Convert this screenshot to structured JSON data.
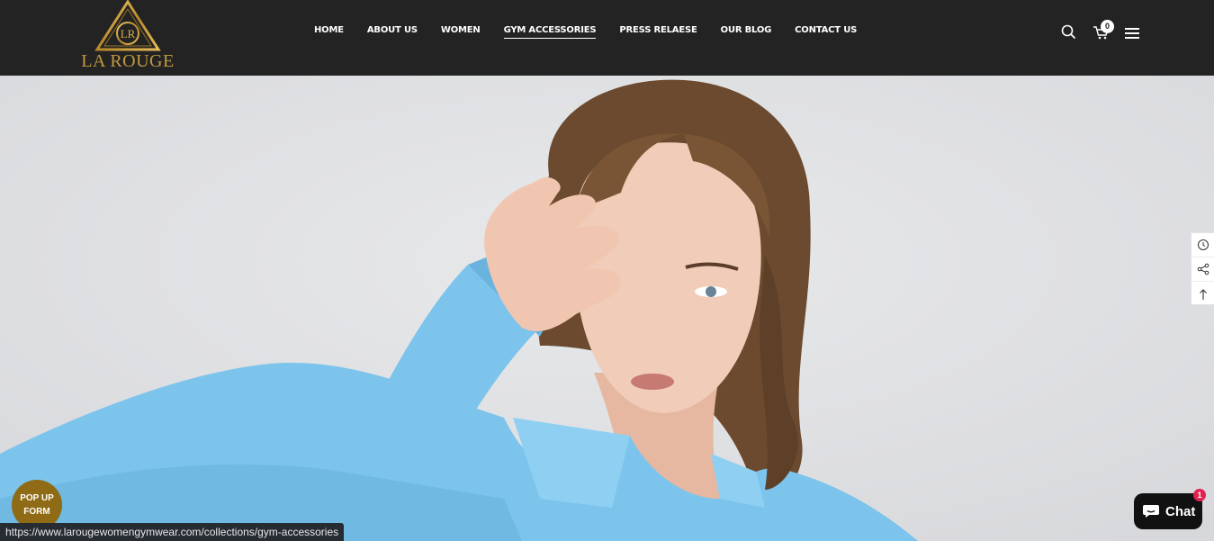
{
  "brand": {
    "name": "LA ROUGE",
    "monogram": "LR",
    "color": "#c29a3e"
  },
  "nav": {
    "items": [
      {
        "label": "HOME"
      },
      {
        "label": "ABOUT US"
      },
      {
        "label": "WOMEN"
      },
      {
        "label": "GYM ACCESSORIES",
        "active": true
      },
      {
        "label": "PRESS RELAESE"
      },
      {
        "label": "OUR BLOG"
      },
      {
        "label": "CONTACT US"
      }
    ]
  },
  "header_icons": {
    "search": "search-icon",
    "cart": "cart-icon",
    "menu": "menu-icon",
    "cart_count": "0"
  },
  "side_tools": [
    "recently-viewed-icon",
    "share-icon",
    "back-to-top-icon"
  ],
  "popup_form": {
    "line1": "POP UP",
    "line2": "FORM",
    "color": "#8e6b14"
  },
  "status_bar": {
    "url": "https://www.larougewomengymwear.com/collections/gym-accessories"
  },
  "chat": {
    "label": "Chat",
    "badge": "1"
  },
  "colors": {
    "header_bg": "#232323",
    "hero_bg": "#dfe0e2",
    "accent": "#c29a3e",
    "jacket": "#7cc4ec"
  }
}
